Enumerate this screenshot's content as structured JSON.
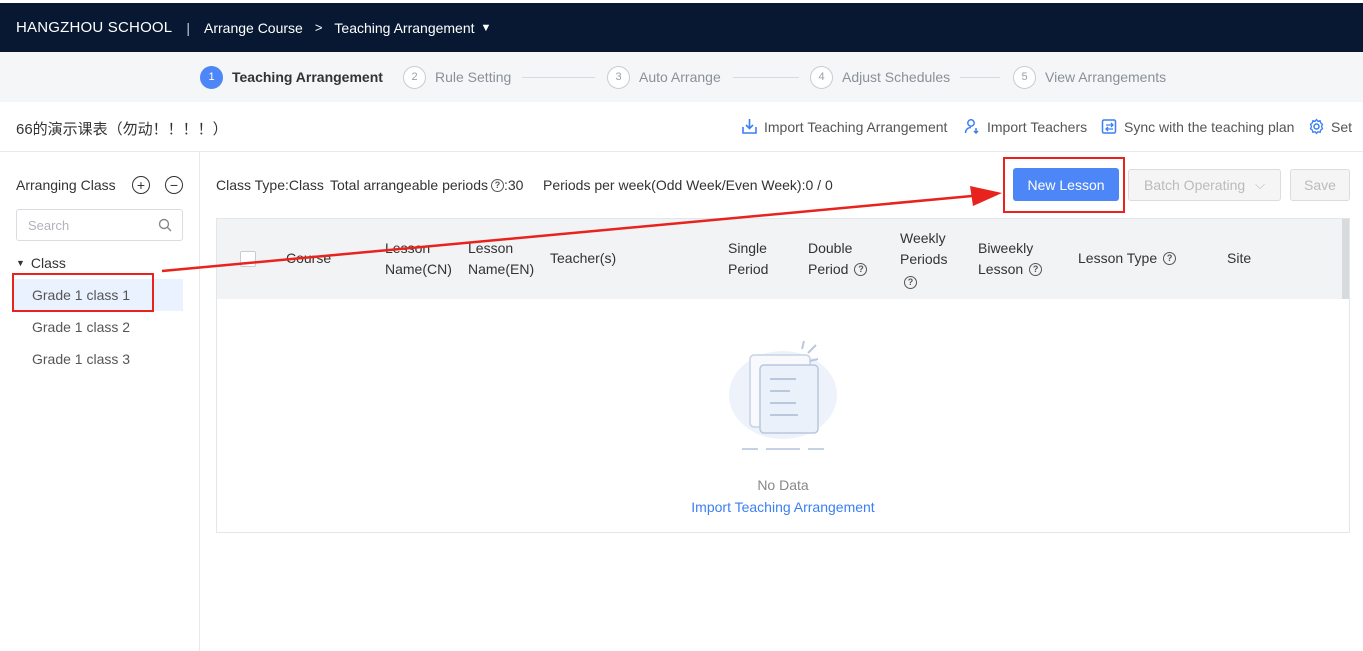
{
  "topbar": {
    "school": "HANGZHOU SCHOOL",
    "separator": "|",
    "crumb1": "Arrange Course",
    "crumb_arrow": ">",
    "crumb2": "Teaching Arrangement",
    "caret": "▼"
  },
  "steps": [
    {
      "num": "1",
      "label": "Teaching Arrangement",
      "active": true
    },
    {
      "num": "2",
      "label": "Rule Setting",
      "active": false
    },
    {
      "num": "3",
      "label": "Auto Arrange",
      "active": false
    },
    {
      "num": "4",
      "label": "Adjust Schedules",
      "active": false
    },
    {
      "num": "5",
      "label": "View Arrangements",
      "active": false
    }
  ],
  "schedule": {
    "title": "66的演示课表（勿动！！！！）",
    "actions": {
      "import_arrangement": "Import Teaching Arrangement",
      "import_teachers": "Import Teachers",
      "sync": "Sync with the teaching plan",
      "set": "Set"
    }
  },
  "sidebar": {
    "heading": "Arranging Class",
    "add": "+",
    "remove": "−",
    "search_placeholder": "Search",
    "root": "Class",
    "items": [
      "Grade 1 class 1",
      "Grade 1 class 2",
      "Grade 1 class 3"
    ],
    "selected_index": 0
  },
  "info": {
    "class_type": "Class Type:Class",
    "total_label": "Total arrangeable periods",
    "total_value": ":30",
    "per_week": "Periods per week(Odd Week/Even Week):0 / 0",
    "q": "?"
  },
  "buttons": {
    "new_lesson": "New Lesson",
    "batch": "Batch Operating",
    "batch_caret": "⌵",
    "save": "Save"
  },
  "table": {
    "headers": {
      "course": "Course",
      "name_cn_1": "Lesson",
      "name_cn_2": "Name(CN)",
      "name_en_1": "Lesson",
      "name_en_2": "Name(EN)",
      "teachers": "Teacher(s)",
      "single_1": "Single",
      "single_2": "Period",
      "double_1": "Double",
      "double_2": "Period",
      "weekly_1": "Weekly",
      "weekly_2": "Periods",
      "biweekly_1": "Biweekly",
      "biweekly_2": "Lesson",
      "lesson_type": "Lesson Type",
      "site": "Site"
    },
    "empty_text": "No Data",
    "empty_link": "Import Teaching Arrangement"
  },
  "colors": {
    "topbar": "#081832",
    "primary": "#4d86f7",
    "annotation": "#e8221c"
  }
}
